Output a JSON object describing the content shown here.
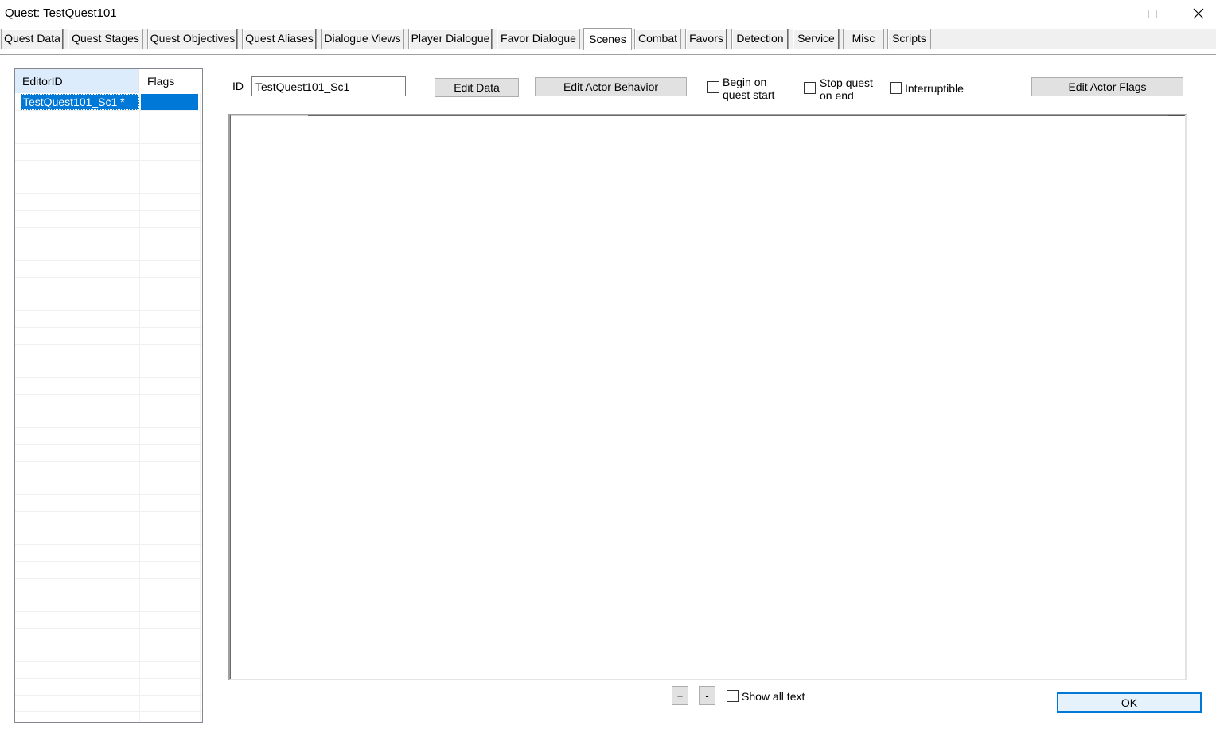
{
  "window": {
    "title": "Quest: TestQuest101",
    "minimize_glyph": "",
    "close_glyph": "✕"
  },
  "tabs": [
    {
      "label": "Quest Data",
      "active": false
    },
    {
      "label": "Quest Stages",
      "active": false
    },
    {
      "label": "Quest Objectives",
      "active": false
    },
    {
      "label": "Quest Aliases",
      "active": false
    },
    {
      "label": "Dialogue Views",
      "active": false
    },
    {
      "label": "Player Dialogue",
      "active": false
    },
    {
      "label": "Favor Dialogue",
      "active": false
    },
    {
      "label": "Scenes",
      "active": true
    },
    {
      "label": "Combat",
      "active": false
    },
    {
      "label": "Favors",
      "active": false
    },
    {
      "label": "Detection",
      "active": false
    },
    {
      "label": "Service",
      "active": false
    },
    {
      "label": "Misc",
      "active": false
    },
    {
      "label": "Scripts",
      "active": false
    }
  ],
  "scene_list": {
    "columns": [
      "EditorID",
      "Flags"
    ],
    "rows": [
      {
        "editor_id": "TestQuest101_Sc1 *",
        "flags": "",
        "selected": true
      }
    ]
  },
  "scene_editor": {
    "id_label": "ID",
    "id_value": "TestQuest101_Sc1",
    "edit_data_label": "Edit Data",
    "edit_actor_behavior_label": "Edit Actor Behavior",
    "begin_on_quest_start": {
      "label_line1": "Begin on",
      "label_line2": "quest start",
      "checked": false
    },
    "stop_quest_on_end": {
      "label_line1": "Stop quest",
      "label_line2": "on end",
      "checked": false
    },
    "interruptible": {
      "label": "Interruptible",
      "checked": false
    },
    "edit_actor_flags_label": "Edit Actor Flags"
  },
  "bottom": {
    "plus_label": "+",
    "minus_label": "-",
    "show_all_text": {
      "label": "Show all text",
      "checked": false
    },
    "ok_label": "OK"
  },
  "colors": {
    "selection": "#0078d7",
    "header_highlight": "#dcecfc",
    "button_face": "#e1e1e1",
    "default_button_border": "#0078d7"
  }
}
